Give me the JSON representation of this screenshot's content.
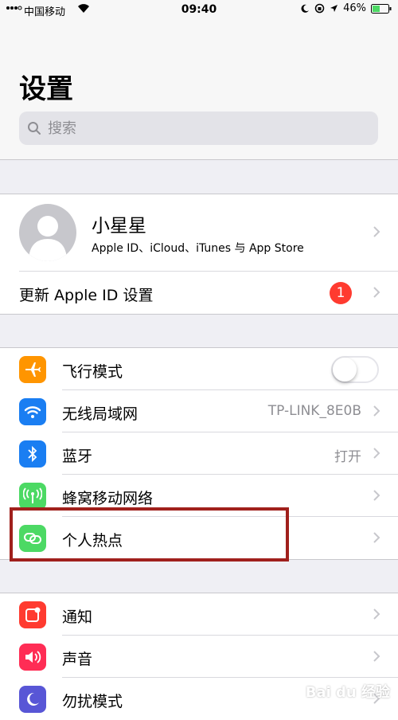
{
  "status_bar": {
    "carrier": "中国移动",
    "time": "09:40",
    "battery": "46%"
  },
  "header": {
    "title": "设置"
  },
  "search": {
    "placeholder": "搜索"
  },
  "profile": {
    "name": "小星星",
    "subtitle": "Apple ID、iCloud、iTunes 与 App Store"
  },
  "update_row": {
    "label": "更新 Apple ID 设置",
    "badge": "1"
  },
  "connectivity": {
    "airplane": {
      "label": "飞行模式",
      "on": false
    },
    "wifi": {
      "label": "无线局域网",
      "value": "TP-LINK_8E0B"
    },
    "bluetooth": {
      "label": "蓝牙",
      "value": "打开"
    },
    "cellular": {
      "label": "蜂窝移动网络"
    },
    "hotspot": {
      "label": "个人热点"
    }
  },
  "notifications_group": {
    "notifications": {
      "label": "通知"
    },
    "sounds": {
      "label": "声音"
    },
    "dnd": {
      "label": "勿扰模式"
    }
  },
  "watermark": "Bai du 经验",
  "colors": {
    "airplane": "#ff9500",
    "wifi": "#1a7ef2",
    "bluetooth": "#1a7ef2",
    "cellular": "#4cd964",
    "hotspot": "#4cd964",
    "notifications": "#ff3b30",
    "sounds": "#ff2d55",
    "dnd": "#5856d6",
    "highlight": "#a0201c"
  }
}
